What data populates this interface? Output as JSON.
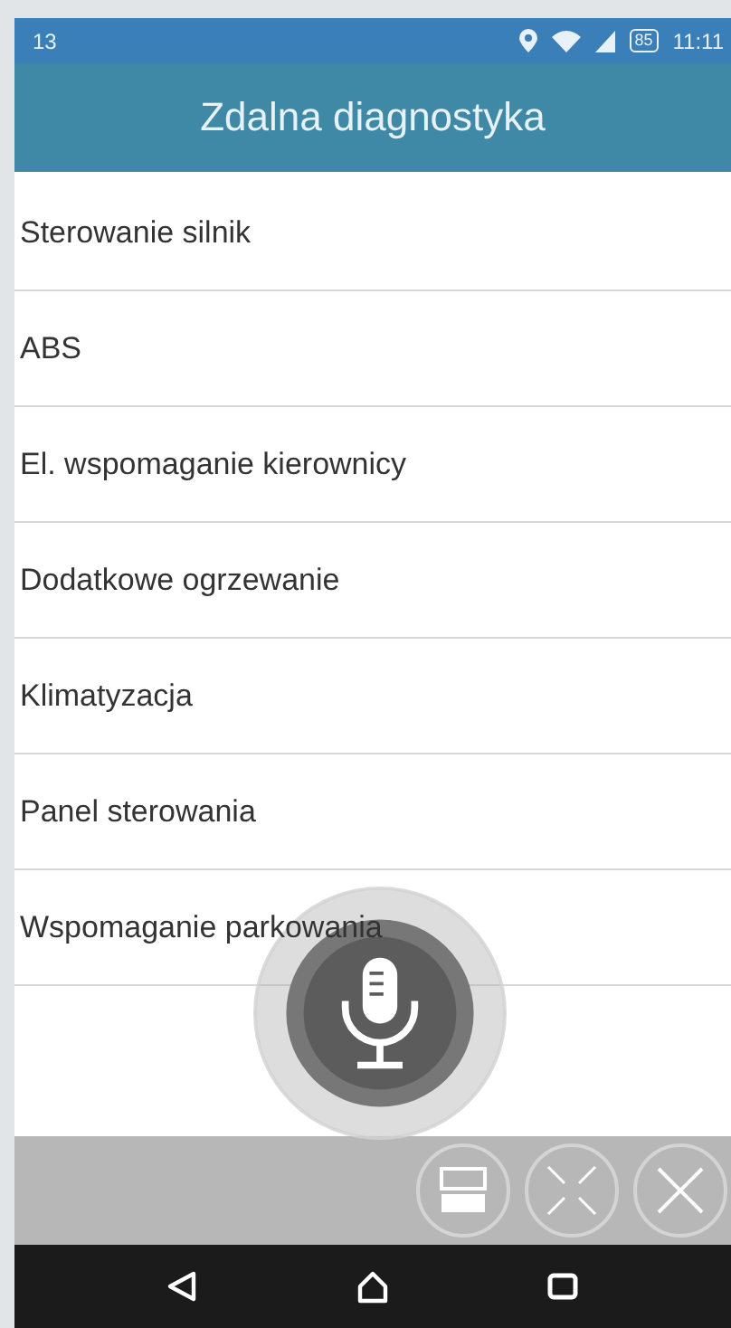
{
  "status_bar": {
    "notification": "13",
    "battery": "85",
    "time": "11:11"
  },
  "title": "Zdalna diagnostyka",
  "items": [
    {
      "label": "Sterowanie silnik"
    },
    {
      "label": "ABS"
    },
    {
      "label": "El. wspomaganie kierownicy"
    },
    {
      "label": "Dodatkowe ogrzewanie"
    },
    {
      "label": "Klimatyzacja"
    },
    {
      "label": "Panel sterowania"
    },
    {
      "label": "Wspomaganie parkowania"
    }
  ],
  "toolbar": [
    {
      "kind": "split"
    },
    {
      "kind": "expand"
    },
    {
      "kind": "close"
    }
  ],
  "nav": [
    {
      "kind": "back"
    },
    {
      "kind": "home"
    },
    {
      "kind": "recents"
    }
  ]
}
